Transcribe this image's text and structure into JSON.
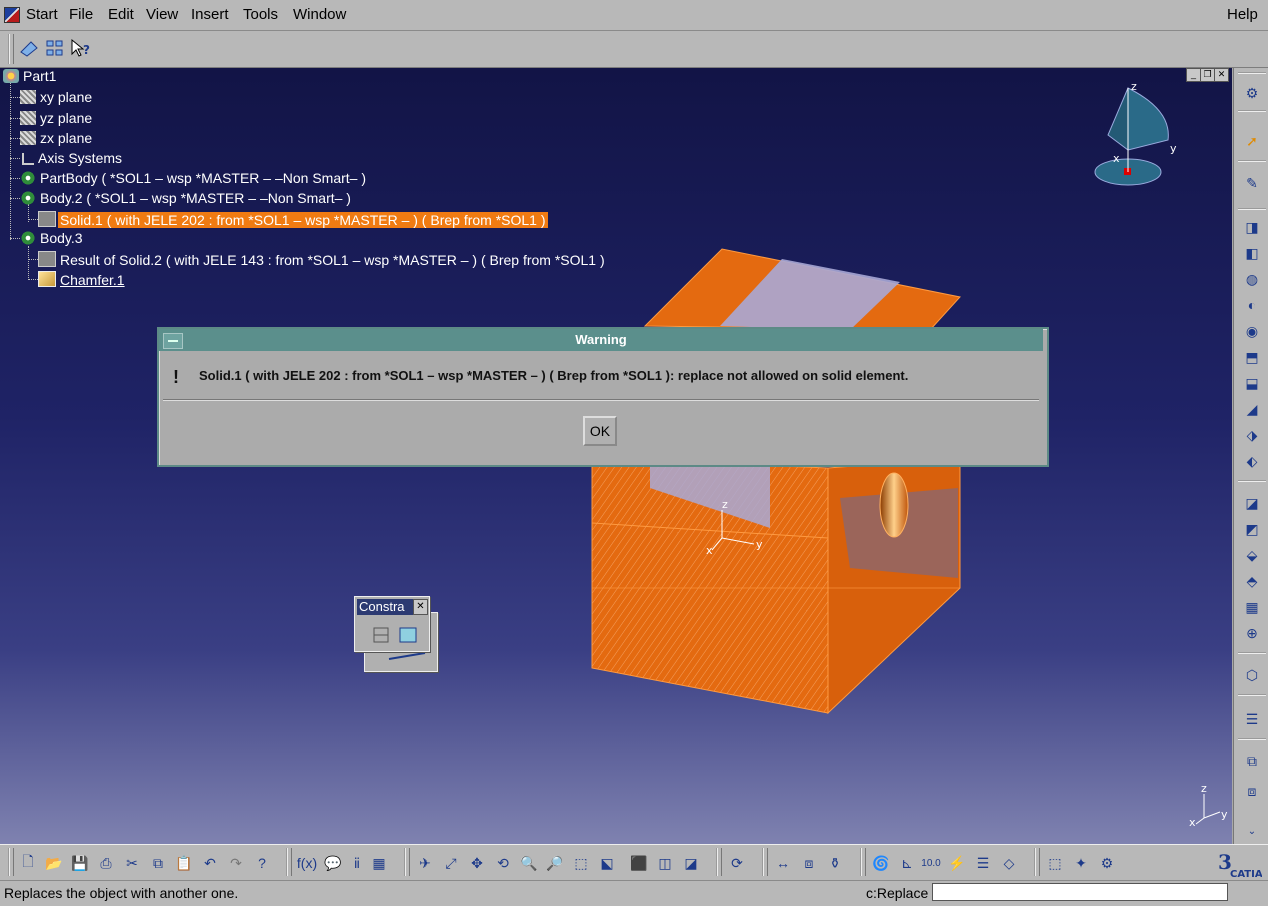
{
  "menubar": {
    "items": [
      "Start",
      "File",
      "Edit",
      "View",
      "Insert",
      "Tools",
      "Window"
    ],
    "help": "Help"
  },
  "tree": {
    "root": "Part1",
    "nodes": [
      "xy plane",
      "yz plane",
      "zx plane",
      "Axis Systems",
      "PartBody ( *SOL1 – wsp *MASTER –  –Non Smart–  )",
      "Body.2 ( *SOL1 – wsp *MASTER –  –Non Smart–  )",
      "Solid.1 (  with JELE 202 : from *SOL1 – wsp *MASTER –  ) ( Brep from *SOL1 )",
      "Body.3",
      "Result of Solid.2 (  with JELE 143 : from *SOL1 – wsp *MASTER –  ) ( Brep from *SOL1 )",
      "Chamfer.1"
    ]
  },
  "compass": {
    "z": "z",
    "y": "y",
    "x": "x"
  },
  "axes3d": {
    "z": "z",
    "y": "y",
    "x": "x"
  },
  "dialog": {
    "title": "Warning",
    "icon": "!",
    "message": "Solid.1 (  with JELE 202 : from *SOL1 – wsp *MASTER –  ) ( Brep from *SOL1 ): replace not allowed on solid element.",
    "ok": "OK"
  },
  "constraint_toolbar": {
    "title": "Constra"
  },
  "status": {
    "message": "Replaces the object with another one.",
    "command_label": "c:Replace",
    "command_value": ""
  },
  "brand": "CATIA",
  "colors": {
    "selection": "#f07b12",
    "solid": "#e46a10",
    "dialog_title": "#5b8f8c",
    "viewport_top": "#121446"
  }
}
